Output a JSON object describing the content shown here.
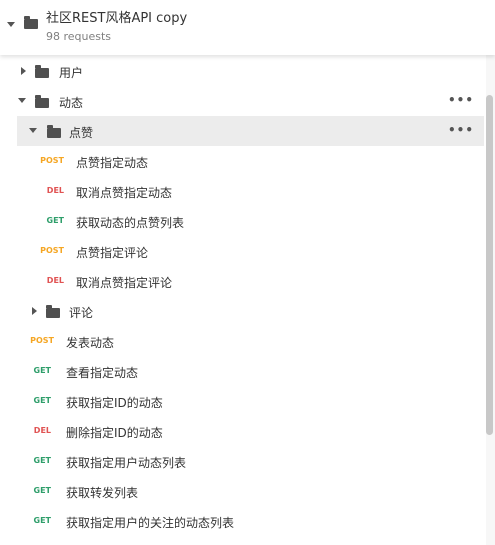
{
  "collection": {
    "name": "社区REST风格API copy",
    "requests_count": "98 requests"
  },
  "tree": {
    "users_folder": "用户",
    "dynamics_folder": "动态",
    "likes_folder": "点赞",
    "likes_items": [
      {
        "method": "POST",
        "name": "点赞指定动态"
      },
      {
        "method": "DEL",
        "name": "取消点赞指定动态"
      },
      {
        "method": "GET",
        "name": "获取动态的点赞列表"
      },
      {
        "method": "POST",
        "name": "点赞指定评论"
      },
      {
        "method": "DEL",
        "name": "取消点赞指定评论"
      }
    ],
    "comments_folder": "评论",
    "dynamics_items": [
      {
        "method": "POST",
        "name": "发表动态"
      },
      {
        "method": "GET",
        "name": "查看指定动态"
      },
      {
        "method": "GET",
        "name": "获取指定ID的动态"
      },
      {
        "method": "DEL",
        "name": "删除指定ID的动态"
      },
      {
        "method": "GET",
        "name": "获取指定用户动态列表"
      },
      {
        "method": "GET",
        "name": "获取转发列表"
      },
      {
        "method": "GET",
        "name": "获取指定用户的关注的动态列表"
      }
    ],
    "more_label": "•••"
  },
  "colors": {
    "post": "#f5a623",
    "get": "#2e9e6a",
    "del": "#e05252"
  }
}
